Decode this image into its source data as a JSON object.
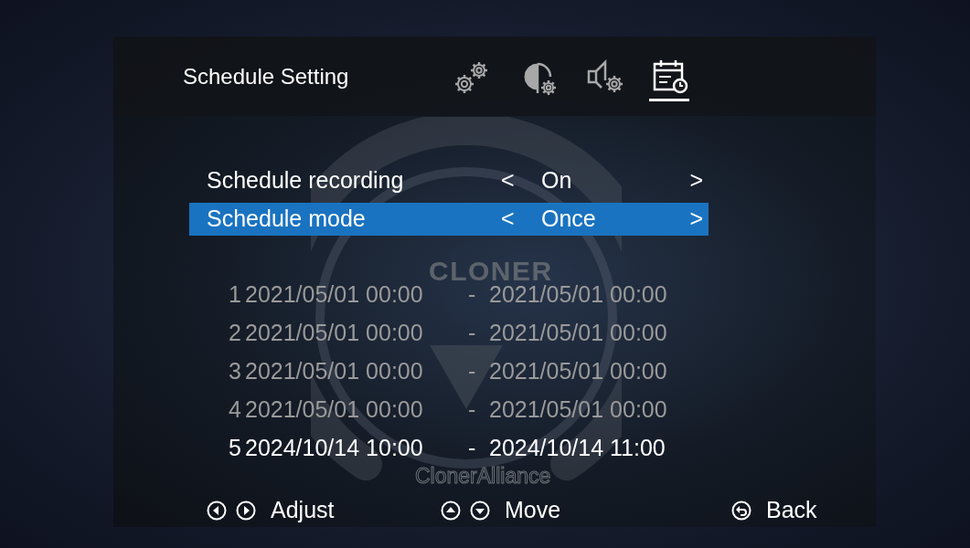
{
  "header": {
    "title": "Schedule Setting",
    "tabs": [
      {
        "kind": "system",
        "selected": false
      },
      {
        "kind": "display",
        "selected": false
      },
      {
        "kind": "audio",
        "selected": false
      },
      {
        "kind": "schedule",
        "selected": true
      }
    ]
  },
  "settings": [
    {
      "label": "Schedule recording",
      "left": "<",
      "value": "On",
      "right": ">",
      "selected": false
    },
    {
      "label": "Schedule mode",
      "left": "<",
      "value": "Once",
      "right": ">",
      "selected": true
    }
  ],
  "slots": [
    {
      "index": "1",
      "start": "2021/05/01 00:00",
      "separator": "-",
      "end": "2021/05/01 00:00",
      "disabled": true
    },
    {
      "index": "2",
      "start": "2021/05/01 00:00",
      "separator": "-",
      "end": "2021/05/01 00:00",
      "disabled": true
    },
    {
      "index": "3",
      "start": "2021/05/01 00:00",
      "separator": "-",
      "end": "2021/05/01 00:00",
      "disabled": true
    },
    {
      "index": "4",
      "start": "2021/05/01 00:00",
      "separator": "-",
      "end": "2021/05/01 00:00",
      "disabled": true
    },
    {
      "index": "5",
      "start": "2024/10/14 10:00",
      "separator": "-",
      "end": "2024/10/14 11:00",
      "disabled": false
    }
  ],
  "background_logo": {
    "title": "CLONER",
    "subtitle": "ClonerAlliance"
  },
  "footer": [
    {
      "kind": "leftright",
      "label": "Adjust"
    },
    {
      "kind": "updown",
      "label": "Move"
    },
    {
      "kind": "back",
      "label": "Back"
    }
  ]
}
